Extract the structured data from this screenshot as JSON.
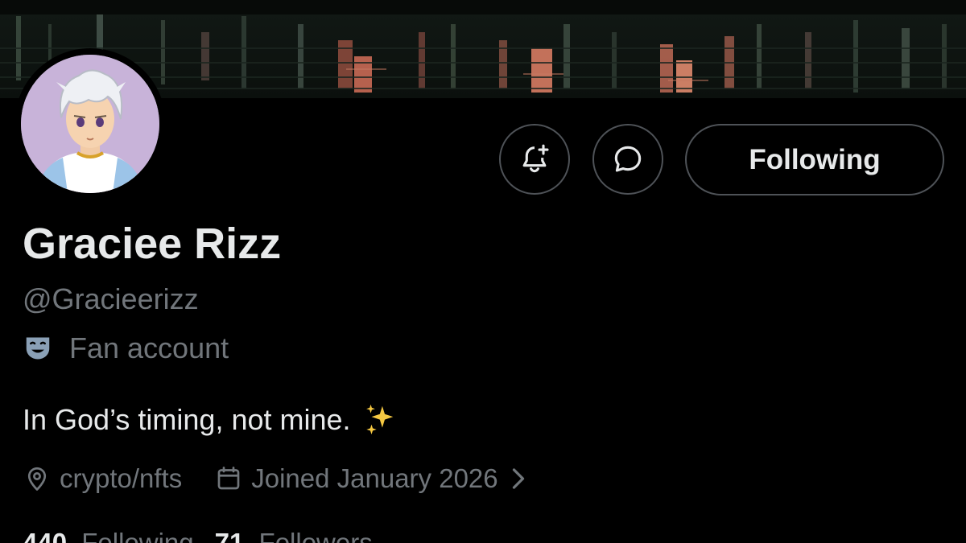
{
  "profile": {
    "display_name": "Graciee Rizz",
    "handle": "@Gracieerizz",
    "label": "Fan account",
    "bio": "In God’s timing, not mine.",
    "location": "crypto/nfts",
    "joined": "Joined January 2026"
  },
  "actions": {
    "following_label": "Following"
  },
  "stats": {
    "following_count": "440",
    "following_label": "Following",
    "followers_count": "71",
    "followers_label": "Followers"
  },
  "icons": {
    "notify": "bell-plus-icon",
    "message": "message-bubble-icon",
    "label": "theater-mask-icon",
    "bio_emoji": "sparkles-icon",
    "location": "location-pin-icon",
    "joined": "calendar-icon",
    "expand": "chevron-right-icon"
  },
  "colors": {
    "background": "#000000",
    "primary_text": "#e7e9ea",
    "secondary_text": "#71767b",
    "button_border": "#4e5257",
    "mask_icon": "#8aa0b6",
    "sparkle": "#f5c842",
    "avatar_bg": "#c8b3d9"
  }
}
